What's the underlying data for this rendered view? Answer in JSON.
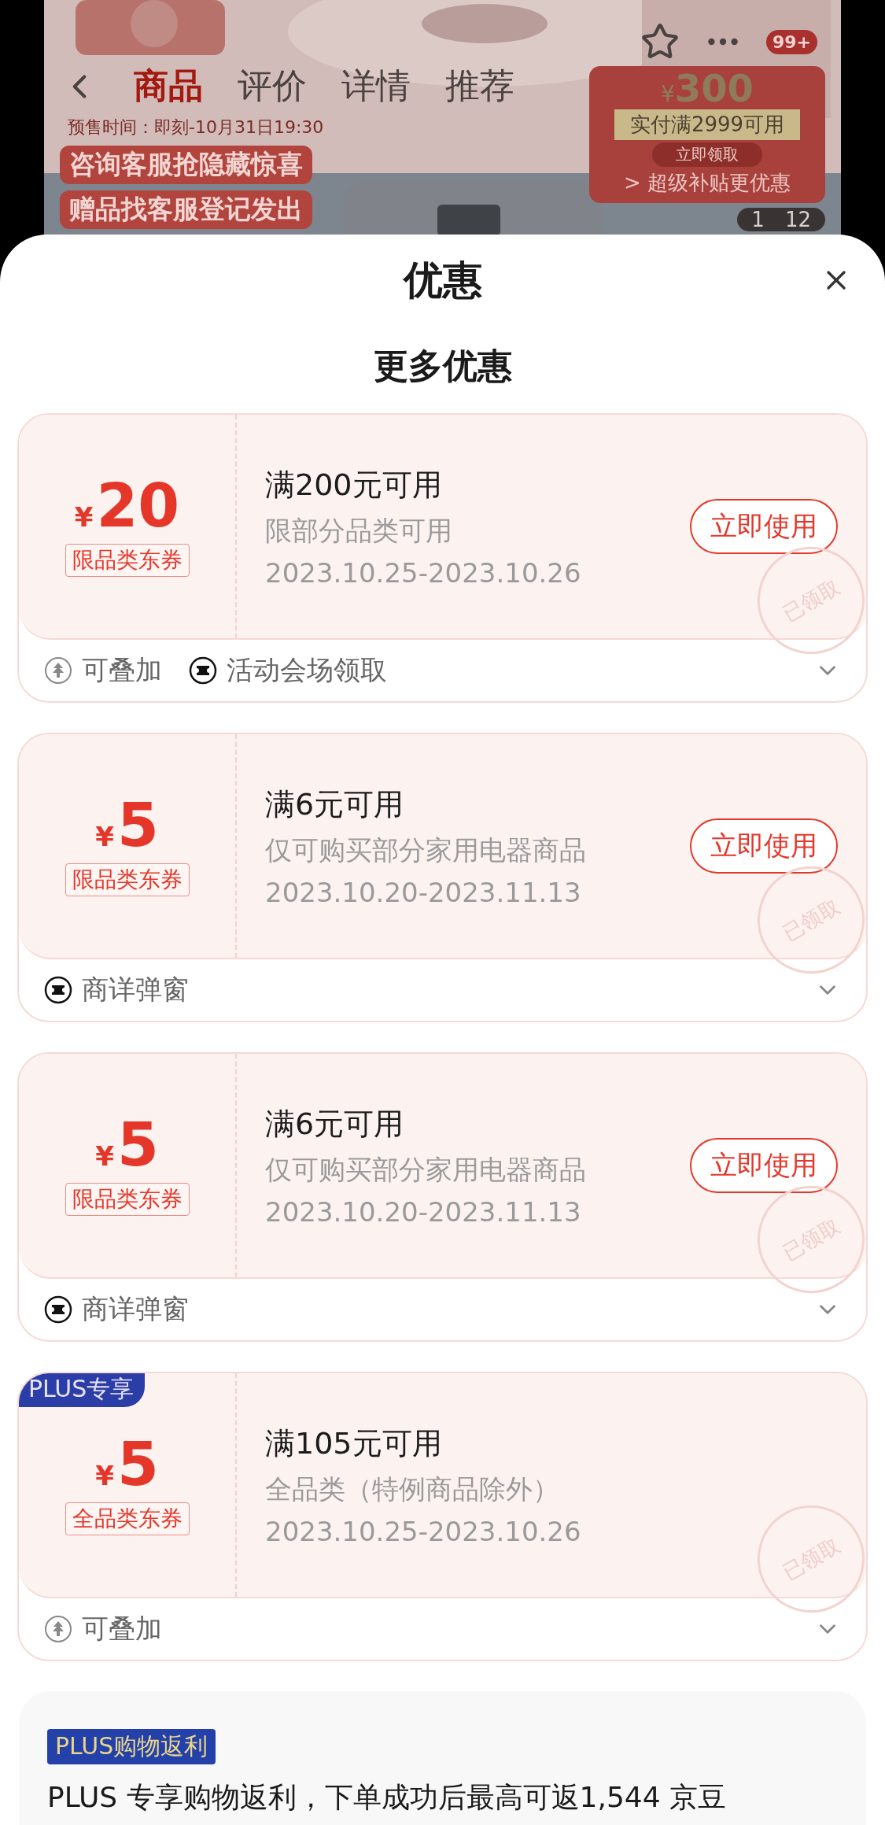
{
  "background": {
    "tabs": [
      {
        "label": "商品",
        "selected": true
      },
      {
        "label": "评价",
        "selected": false
      },
      {
        "label": "详情",
        "selected": false
      },
      {
        "label": "推荐",
        "selected": false
      }
    ],
    "presale": "预售时间：即刻-10月31日19:30",
    "banners": [
      "咨询客服抢隐藏惊喜",
      "赠品找客服登记发出"
    ],
    "promo": {
      "currency": "¥",
      "amount": "300",
      "condition": "实付满2999可用",
      "action": "立即领取",
      "link": "> 超级补贴更优惠"
    },
    "cart_badge": "99+",
    "pager": {
      "current": "1",
      "total": "12"
    }
  },
  "sheet": {
    "title": "优惠",
    "section_title": "更多优惠",
    "coupons": [
      {
        "currency": "¥",
        "amount": "20",
        "type_tag": "限品类东券",
        "title": "满200元可用",
        "scope": "限部分品类可用",
        "validity": "2023.10.25-2023.10.26",
        "action": "立即使用",
        "stamp": "已领取",
        "footer": [
          {
            "kind": "stackable",
            "label": "可叠加"
          },
          {
            "kind": "venue",
            "label": "活动会场领取"
          }
        ]
      },
      {
        "currency": "¥",
        "amount": "5",
        "type_tag": "限品类东券",
        "title": "满6元可用",
        "scope": "仅可购买部分家用电器商品",
        "validity": "2023.10.20-2023.11.13",
        "action": "立即使用",
        "stamp": "已领取",
        "footer": [
          {
            "kind": "venue",
            "label": "商详弹窗"
          }
        ]
      },
      {
        "currency": "¥",
        "amount": "5",
        "type_tag": "限品类东券",
        "title": "满6元可用",
        "scope": "仅可购买部分家用电器商品",
        "validity": "2023.10.20-2023.11.13",
        "action": "立即使用",
        "stamp": "已领取",
        "footer": [
          {
            "kind": "venue",
            "label": "商详弹窗"
          }
        ]
      },
      {
        "badge": "PLUS专享",
        "currency": "¥",
        "amount": "5",
        "type_tag": "全品类东券",
        "title": "满105元可用",
        "scope": "全品类（特例商品除外）",
        "validity": "2023.10.25-2023.10.26",
        "stamp": "已领取",
        "footer": [
          {
            "kind": "stackable",
            "label": "可叠加"
          }
        ]
      }
    ],
    "rebate": {
      "tag": "PLUS购物返利",
      "text": "PLUS 专享购物返利，下单成功后最高可返1,544 京豆"
    }
  }
}
